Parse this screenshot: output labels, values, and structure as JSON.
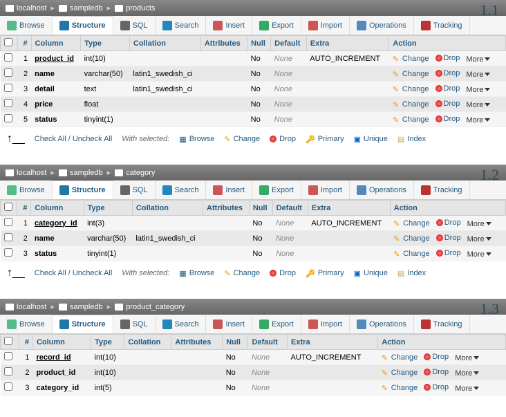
{
  "panels": [
    {
      "version": "1.1",
      "breadcrumb": [
        "localhost",
        "sampledb",
        "products"
      ],
      "columns": [
        {
          "n": 1,
          "name": "product_id",
          "pk": true,
          "type": "int(10)",
          "coll": "",
          "attr": "",
          "null": "No",
          "def": "None",
          "extra": "AUTO_INCREMENT"
        },
        {
          "n": 2,
          "name": "name",
          "type": "varchar(50)",
          "coll": "latin1_swedish_ci",
          "attr": "",
          "null": "No",
          "def": "None",
          "extra": ""
        },
        {
          "n": 3,
          "name": "detail",
          "type": "text",
          "coll": "latin1_swedish_ci",
          "attr": "",
          "null": "No",
          "def": "None",
          "extra": ""
        },
        {
          "n": 4,
          "name": "price",
          "type": "float",
          "coll": "",
          "attr": "",
          "null": "No",
          "def": "None",
          "extra": ""
        },
        {
          "n": 5,
          "name": "status",
          "type": "tinyint(1)",
          "coll": "",
          "attr": "",
          "null": "No",
          "def": "None",
          "extra": ""
        }
      ]
    },
    {
      "version": "1.2",
      "breadcrumb": [
        "localhost",
        "sampledb",
        "category"
      ],
      "columns": [
        {
          "n": 1,
          "name": "category_id",
          "pk": true,
          "type": "int(3)",
          "coll": "",
          "attr": "",
          "null": "No",
          "def": "None",
          "extra": "AUTO_INCREMENT"
        },
        {
          "n": 2,
          "name": "name",
          "type": "varchar(50)",
          "coll": "latin1_swedish_ci",
          "attr": "",
          "null": "No",
          "def": "None",
          "extra": ""
        },
        {
          "n": 3,
          "name": "status",
          "type": "tinyint(1)",
          "coll": "",
          "attr": "",
          "null": "No",
          "def": "None",
          "extra": ""
        }
      ]
    },
    {
      "version": "1.3",
      "breadcrumb": [
        "localhost",
        "sampledb",
        "product_category"
      ],
      "noFooter": true,
      "columns": [
        {
          "n": 1,
          "name": "record_id",
          "pk": true,
          "type": "int(10)",
          "coll": "",
          "attr": "",
          "null": "No",
          "def": "None",
          "extra": "AUTO_INCREMENT"
        },
        {
          "n": 2,
          "name": "product_id",
          "type": "int(10)",
          "coll": "",
          "attr": "",
          "null": "No",
          "def": "None",
          "extra": ""
        },
        {
          "n": 3,
          "name": "category_id",
          "type": "int(5)",
          "coll": "",
          "attr": "",
          "null": "No",
          "def": "None",
          "extra": ""
        }
      ]
    }
  ],
  "tabs": [
    {
      "id": "browse",
      "label": "Browse"
    },
    {
      "id": "structure",
      "label": "Structure",
      "active": true
    },
    {
      "id": "sql",
      "label": "SQL"
    },
    {
      "id": "search",
      "label": "Search"
    },
    {
      "id": "insert",
      "label": "Insert"
    },
    {
      "id": "export",
      "label": "Export"
    },
    {
      "id": "import",
      "label": "Import"
    },
    {
      "id": "operations",
      "label": "Operations"
    },
    {
      "id": "tracking",
      "label": "Tracking"
    }
  ],
  "headers": {
    "num": "#",
    "column": "Column",
    "type": "Type",
    "collation": "Collation",
    "attributes": "Attributes",
    "null": "Null",
    "default": "Default",
    "extra": "Extra",
    "action": "Action"
  },
  "actions": {
    "change": "Change",
    "drop": "Drop",
    "more": "More"
  },
  "footer": {
    "checkAll": "Check All / Uncheck All",
    "withSelected": "With selected:",
    "browse": "Browse",
    "change": "Change",
    "drop": "Drop",
    "primary": "Primary",
    "unique": "Unique",
    "index": "Index"
  }
}
